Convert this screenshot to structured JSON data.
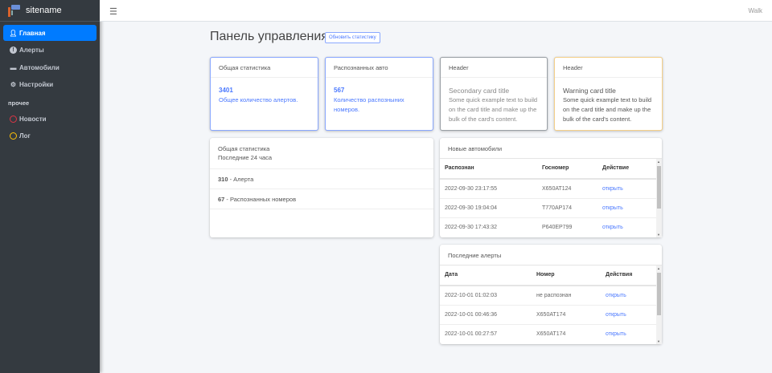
{
  "brand": {
    "name": "sitename"
  },
  "sidebar": {
    "items": [
      {
        "label": "Главная",
        "icon": "user-icon",
        "active": true
      },
      {
        "label": "Алерты",
        "icon": "exclamation-circle-icon"
      },
      {
        "label": "Автомобили",
        "icon": "car-icon"
      },
      {
        "label": "Настройки",
        "icon": "gear-icon"
      }
    ],
    "section": "прочее",
    "extra": [
      {
        "label": "Новости",
        "icon": "circle-icon",
        "color": "#dc3545"
      },
      {
        "label": "Лог",
        "icon": "circle-icon",
        "color": "#ffc107"
      }
    ]
  },
  "topbar": {
    "user": "Walk"
  },
  "page": {
    "title": "Панель управления",
    "refresh": "Обновить статистику"
  },
  "cards": [
    {
      "header": "Общая статистика",
      "value": "3401",
      "text": "Общее количество алертов.",
      "color": "#8aa8ff"
    },
    {
      "header": "Распознанных авто",
      "value": "567",
      "text": "Количество распозныних номеров.",
      "color": "#8aa8ff"
    },
    {
      "header": "Header",
      "title": "Secondary card title",
      "text": "Some quick example text to build on the card title and make up the bulk of the card's content.",
      "color": "#9aa0a6"
    },
    {
      "header": "Header",
      "title": "Warning card title",
      "text": "Some quick example text to build on the card title and make up the bulk of the card's content.",
      "color": "#f5d08a"
    }
  ],
  "stats": {
    "title": "Общая статистика",
    "subtitle": "Последние 24 часа",
    "rows": [
      {
        "value": "310",
        "label": " - Алерта"
      },
      {
        "value": "67",
        "label": " - Распознанных номеров"
      }
    ]
  },
  "cars": {
    "title": "Новые автомобили",
    "columns": [
      "Распознан",
      "Госномер",
      "Действие"
    ],
    "rows": [
      [
        "2022-09-30 23:17:55",
        "X650AT124",
        "открыть"
      ],
      [
        "2022-09-30 19:04:04",
        "T770AP174",
        "открыть"
      ],
      [
        "2022-09-30 17:43:32",
        "P640EP799",
        "открыть"
      ]
    ]
  },
  "alerts": {
    "title": "Последние алерты",
    "columns": [
      "Дата",
      "Номер",
      "Действия"
    ],
    "rows": [
      [
        "2022-10-01 01:02:03",
        "не распознан",
        "открыть"
      ],
      [
        "2022-10-01 00:46:36",
        "X650AT174",
        "открыть"
      ],
      [
        "2022-10-01 00:27:57",
        "X650AT174",
        "открыть"
      ]
    ]
  }
}
